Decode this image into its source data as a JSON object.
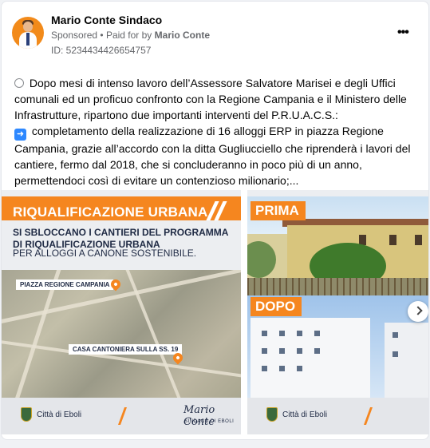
{
  "post": {
    "page_name": "Mario Conte Sindaco",
    "sponsored_label": "Sponsored",
    "paid_for_prefix": "Paid for by",
    "paid_by": "Mario Conte",
    "ad_id": "ID: 5234434426654757",
    "more_label": "•••",
    "text_line1": "Dopo mesi di intenso lavoro dell’Assessore Salvatore Marisei e degli Uffici comunali ed un proficuo confronto con la Regione Campania e il Ministero delle Infrastrutture, ripartono due importanti interventi del P.R.U.A.C.S.:",
    "text_line2": "completamento della realizzazione di 16 alloggi ERP in piazza Regione Campania, grazie all’accordo con la ditta Gugliucciello che riprenderà i lavori del cantiere, fermo dal 2018, che si concluderanno in poco più di un anno, permettendoci così di evitare un contenzioso milionario;..."
  },
  "slide1": {
    "banner": "RIQUALIFICAZIONE URBANA",
    "subtitle": "SI SBLOCCANO I CANTIERI DEL PROGRAMMA DI RIQUALIFICAZIONE URBANA",
    "subtitle2": "PER ALLOGGI A CANONE SOSTENIBILE.",
    "map_label1": "PIAZZA REGIONE CAMPANIA",
    "map_label2": "CASA CANTONIERA SULLA SS. 19",
    "city": "Città di Eboli",
    "signature": "Mario Conte",
    "signature_sub": "SINDACO DI EBOLI"
  },
  "slide2": {
    "before_label": "PRIMA",
    "after_label": "DOPO",
    "city": "Città di Eboli"
  },
  "icons": {
    "post_circle": "circle-icon",
    "bullet_arrow": "right-arrow-icon",
    "more": "more-icon",
    "next": "chevron-right-icon"
  },
  "colors": {
    "accent": "#f5861f",
    "meta_gray": "#65676b",
    "navy": "#1f2a44"
  }
}
